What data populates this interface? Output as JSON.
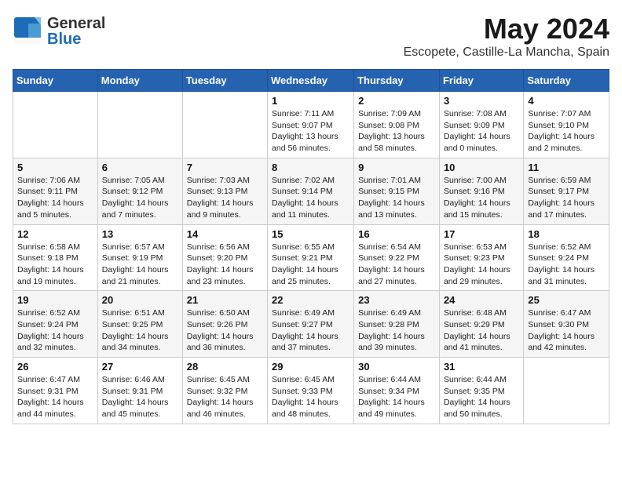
{
  "header": {
    "logo_general": "General",
    "logo_blue": "Blue",
    "title": "May 2024",
    "subtitle": "Escopete, Castille-La Mancha, Spain"
  },
  "calendar": {
    "days_of_week": [
      "Sunday",
      "Monday",
      "Tuesday",
      "Wednesday",
      "Thursday",
      "Friday",
      "Saturday"
    ],
    "weeks": [
      [
        {
          "day": "",
          "info": ""
        },
        {
          "day": "",
          "info": ""
        },
        {
          "day": "",
          "info": ""
        },
        {
          "day": "1",
          "info": "Sunrise: 7:11 AM\nSunset: 9:07 PM\nDaylight: 13 hours\nand 56 minutes."
        },
        {
          "day": "2",
          "info": "Sunrise: 7:09 AM\nSunset: 9:08 PM\nDaylight: 13 hours\nand 58 minutes."
        },
        {
          "day": "3",
          "info": "Sunrise: 7:08 AM\nSunset: 9:09 PM\nDaylight: 14 hours\nand 0 minutes."
        },
        {
          "day": "4",
          "info": "Sunrise: 7:07 AM\nSunset: 9:10 PM\nDaylight: 14 hours\nand 2 minutes."
        }
      ],
      [
        {
          "day": "5",
          "info": "Sunrise: 7:06 AM\nSunset: 9:11 PM\nDaylight: 14 hours\nand 5 minutes."
        },
        {
          "day": "6",
          "info": "Sunrise: 7:05 AM\nSunset: 9:12 PM\nDaylight: 14 hours\nand 7 minutes."
        },
        {
          "day": "7",
          "info": "Sunrise: 7:03 AM\nSunset: 9:13 PM\nDaylight: 14 hours\nand 9 minutes."
        },
        {
          "day": "8",
          "info": "Sunrise: 7:02 AM\nSunset: 9:14 PM\nDaylight: 14 hours\nand 11 minutes."
        },
        {
          "day": "9",
          "info": "Sunrise: 7:01 AM\nSunset: 9:15 PM\nDaylight: 14 hours\nand 13 minutes."
        },
        {
          "day": "10",
          "info": "Sunrise: 7:00 AM\nSunset: 9:16 PM\nDaylight: 14 hours\nand 15 minutes."
        },
        {
          "day": "11",
          "info": "Sunrise: 6:59 AM\nSunset: 9:17 PM\nDaylight: 14 hours\nand 17 minutes."
        }
      ],
      [
        {
          "day": "12",
          "info": "Sunrise: 6:58 AM\nSunset: 9:18 PM\nDaylight: 14 hours\nand 19 minutes."
        },
        {
          "day": "13",
          "info": "Sunrise: 6:57 AM\nSunset: 9:19 PM\nDaylight: 14 hours\nand 21 minutes."
        },
        {
          "day": "14",
          "info": "Sunrise: 6:56 AM\nSunset: 9:20 PM\nDaylight: 14 hours\nand 23 minutes."
        },
        {
          "day": "15",
          "info": "Sunrise: 6:55 AM\nSunset: 9:21 PM\nDaylight: 14 hours\nand 25 minutes."
        },
        {
          "day": "16",
          "info": "Sunrise: 6:54 AM\nSunset: 9:22 PM\nDaylight: 14 hours\nand 27 minutes."
        },
        {
          "day": "17",
          "info": "Sunrise: 6:53 AM\nSunset: 9:23 PM\nDaylight: 14 hours\nand 29 minutes."
        },
        {
          "day": "18",
          "info": "Sunrise: 6:52 AM\nSunset: 9:24 PM\nDaylight: 14 hours\nand 31 minutes."
        }
      ],
      [
        {
          "day": "19",
          "info": "Sunrise: 6:52 AM\nSunset: 9:24 PM\nDaylight: 14 hours\nand 32 minutes."
        },
        {
          "day": "20",
          "info": "Sunrise: 6:51 AM\nSunset: 9:25 PM\nDaylight: 14 hours\nand 34 minutes."
        },
        {
          "day": "21",
          "info": "Sunrise: 6:50 AM\nSunset: 9:26 PM\nDaylight: 14 hours\nand 36 minutes."
        },
        {
          "day": "22",
          "info": "Sunrise: 6:49 AM\nSunset: 9:27 PM\nDaylight: 14 hours\nand 37 minutes."
        },
        {
          "day": "23",
          "info": "Sunrise: 6:49 AM\nSunset: 9:28 PM\nDaylight: 14 hours\nand 39 minutes."
        },
        {
          "day": "24",
          "info": "Sunrise: 6:48 AM\nSunset: 9:29 PM\nDaylight: 14 hours\nand 41 minutes."
        },
        {
          "day": "25",
          "info": "Sunrise: 6:47 AM\nSunset: 9:30 PM\nDaylight: 14 hours\nand 42 minutes."
        }
      ],
      [
        {
          "day": "26",
          "info": "Sunrise: 6:47 AM\nSunset: 9:31 PM\nDaylight: 14 hours\nand 44 minutes."
        },
        {
          "day": "27",
          "info": "Sunrise: 6:46 AM\nSunset: 9:31 PM\nDaylight: 14 hours\nand 45 minutes."
        },
        {
          "day": "28",
          "info": "Sunrise: 6:45 AM\nSunset: 9:32 PM\nDaylight: 14 hours\nand 46 minutes."
        },
        {
          "day": "29",
          "info": "Sunrise: 6:45 AM\nSunset: 9:33 PM\nDaylight: 14 hours\nand 48 minutes."
        },
        {
          "day": "30",
          "info": "Sunrise: 6:44 AM\nSunset: 9:34 PM\nDaylight: 14 hours\nand 49 minutes."
        },
        {
          "day": "31",
          "info": "Sunrise: 6:44 AM\nSunset: 9:35 PM\nDaylight: 14 hours\nand 50 minutes."
        },
        {
          "day": "",
          "info": ""
        }
      ]
    ]
  }
}
